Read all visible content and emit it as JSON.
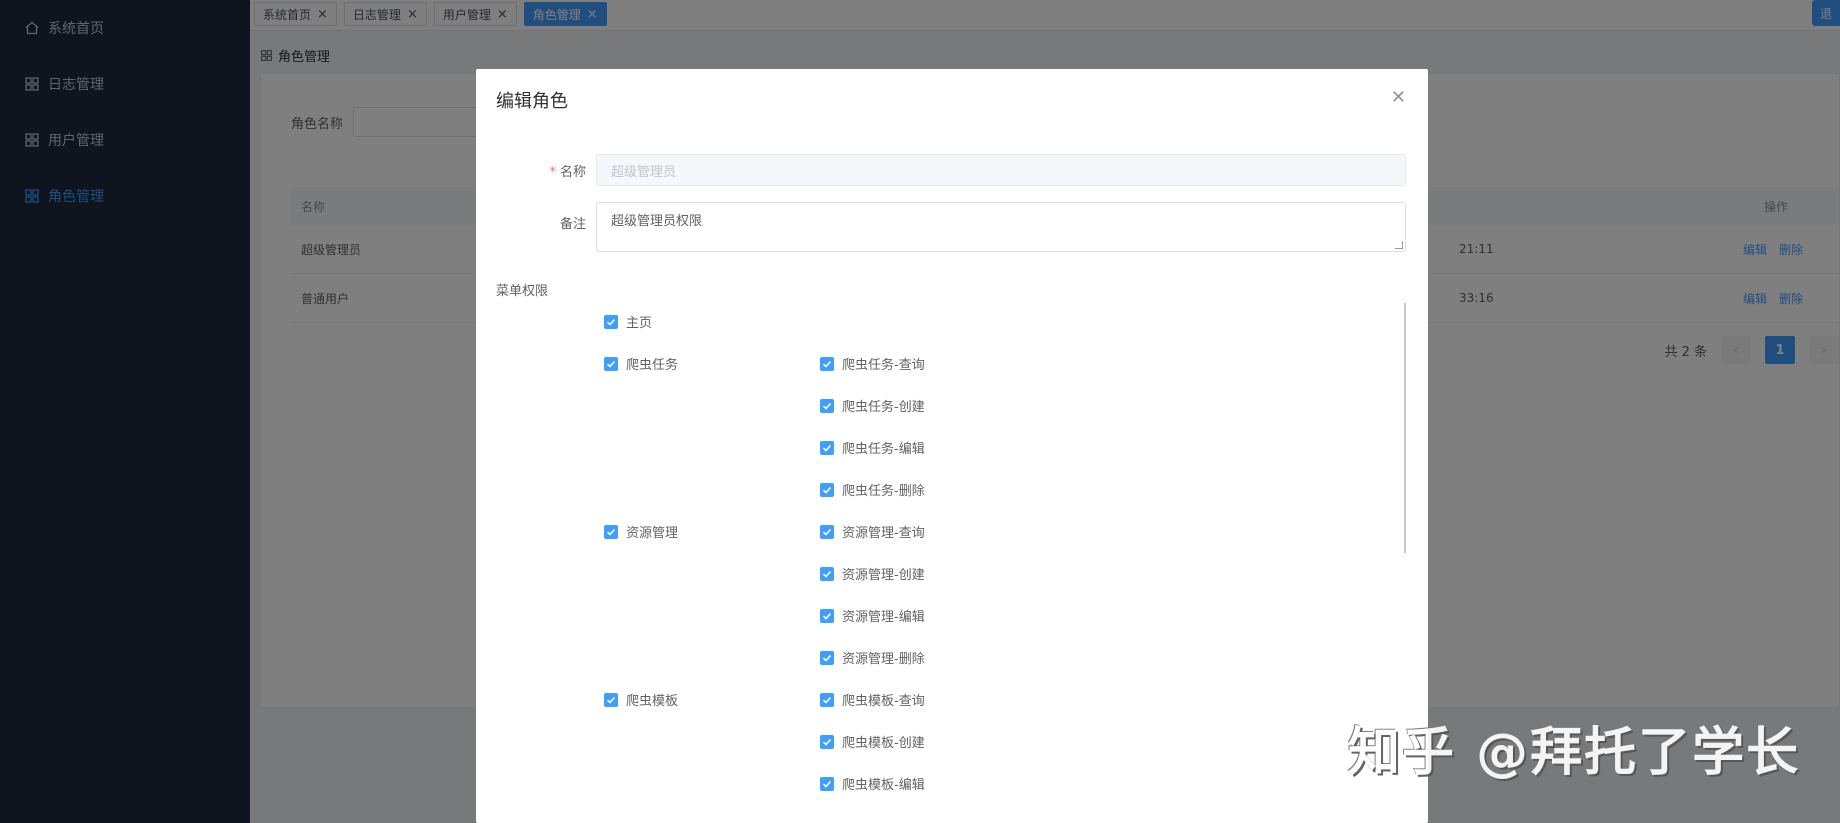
{
  "sidebar": {
    "items": [
      {
        "label": "系统首页",
        "icon": "home-icon",
        "active": false
      },
      {
        "label": "日志管理",
        "icon": "grid-icon",
        "active": false
      },
      {
        "label": "用户管理",
        "icon": "grid-icon",
        "active": false
      },
      {
        "label": "角色管理",
        "icon": "grid-icon",
        "active": true
      }
    ]
  },
  "tabs": [
    {
      "label": "系统首页",
      "active": false
    },
    {
      "label": "日志管理",
      "active": false
    },
    {
      "label": "用户管理",
      "active": false
    },
    {
      "label": "角色管理",
      "active": true
    }
  ],
  "top_right_button": {
    "label": "退"
  },
  "breadcrumb": {
    "label": "角色管理"
  },
  "search": {
    "label": "角色名称",
    "value": ""
  },
  "table": {
    "columns": {
      "name": "名称",
      "ops": "操作"
    },
    "rows": [
      {
        "name": "超级管理员",
        "time": "21:11",
        "edit": "编辑",
        "delete": "删除"
      },
      {
        "name": "普通用户",
        "time": "33:16",
        "edit": "编辑",
        "delete": "删除"
      }
    ]
  },
  "pagination": {
    "total": "共 2 条",
    "current": "1"
  },
  "dialog": {
    "title": "编辑角色",
    "name_label": "名称",
    "name_value": "超级管理员",
    "remark_label": "备注",
    "remark_value": "超级管理员权限",
    "perm_label": "菜单权限",
    "permissions": [
      {
        "label": "主页",
        "checked": true,
        "children": []
      },
      {
        "label": "爬虫任务",
        "checked": true,
        "children": [
          {
            "label": "爬虫任务-查询",
            "checked": true
          },
          {
            "label": "爬虫任务-创建",
            "checked": true
          },
          {
            "label": "爬虫任务-编辑",
            "checked": true
          },
          {
            "label": "爬虫任务-删除",
            "checked": true
          }
        ]
      },
      {
        "label": "资源管理",
        "checked": true,
        "children": [
          {
            "label": "资源管理-查询",
            "checked": true
          },
          {
            "label": "资源管理-创建",
            "checked": true
          },
          {
            "label": "资源管理-编辑",
            "checked": true
          },
          {
            "label": "资源管理-删除",
            "checked": true
          }
        ]
      },
      {
        "label": "爬虫模板",
        "checked": true,
        "children": [
          {
            "label": "爬虫模板-查询",
            "checked": true
          },
          {
            "label": "爬虫模板-创建",
            "checked": true
          },
          {
            "label": "爬虫模板-编辑",
            "checked": true
          }
        ]
      }
    ]
  },
  "watermark": "知乎 @拜托了学长",
  "colors": {
    "primary": "#409eff",
    "sidebar": "#1c2a3e",
    "danger": "#f56c6c"
  }
}
